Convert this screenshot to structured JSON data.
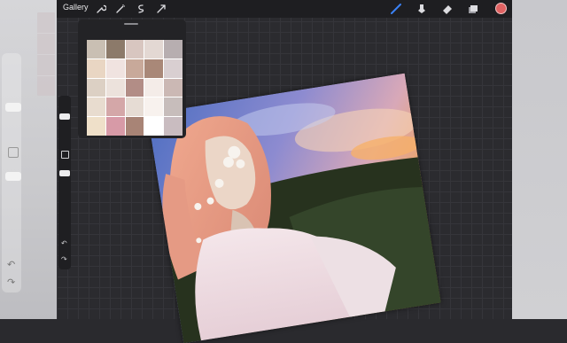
{
  "toolbar": {
    "gallery_label": "Gallery",
    "left_tools": [
      "wrench-icon",
      "magic-wand-icon",
      "selection-icon",
      "transform-arrow-icon"
    ],
    "right_tools": [
      "brush-icon",
      "smudge-icon",
      "eraser-icon",
      "layers-icon"
    ],
    "active_color": "#e06262"
  },
  "sidebar": {
    "undo_glyph": "↶",
    "redo_glyph": "↷"
  },
  "reference_panel": {
    "tile_colors": [
      "#c9bfb3",
      "#8c7a6a",
      "#d8c6c0",
      "#e3d8d3",
      "#b7aeb0",
      "#e9d6c3",
      "#f0e3e0",
      "#c8a99a",
      "#a98878",
      "#d9cfd1",
      "#dcd0c4",
      "#ece2dc",
      "#b28d86",
      "#f4ece8",
      "#cbb8b4",
      "#e8dccf",
      "#d4a7a8",
      "#e6dcd4",
      "#f8f2ee",
      "#c7bdbb",
      "#efe0c9",
      "#d79aa7",
      "#a88476",
      "#ffffff",
      "#c9bcc0"
    ]
  },
  "colors": {
    "canvas_bg": "#2b2b2f",
    "toolbar_bg": "#1e1e21",
    "accent_blue": "#3b82f6"
  }
}
